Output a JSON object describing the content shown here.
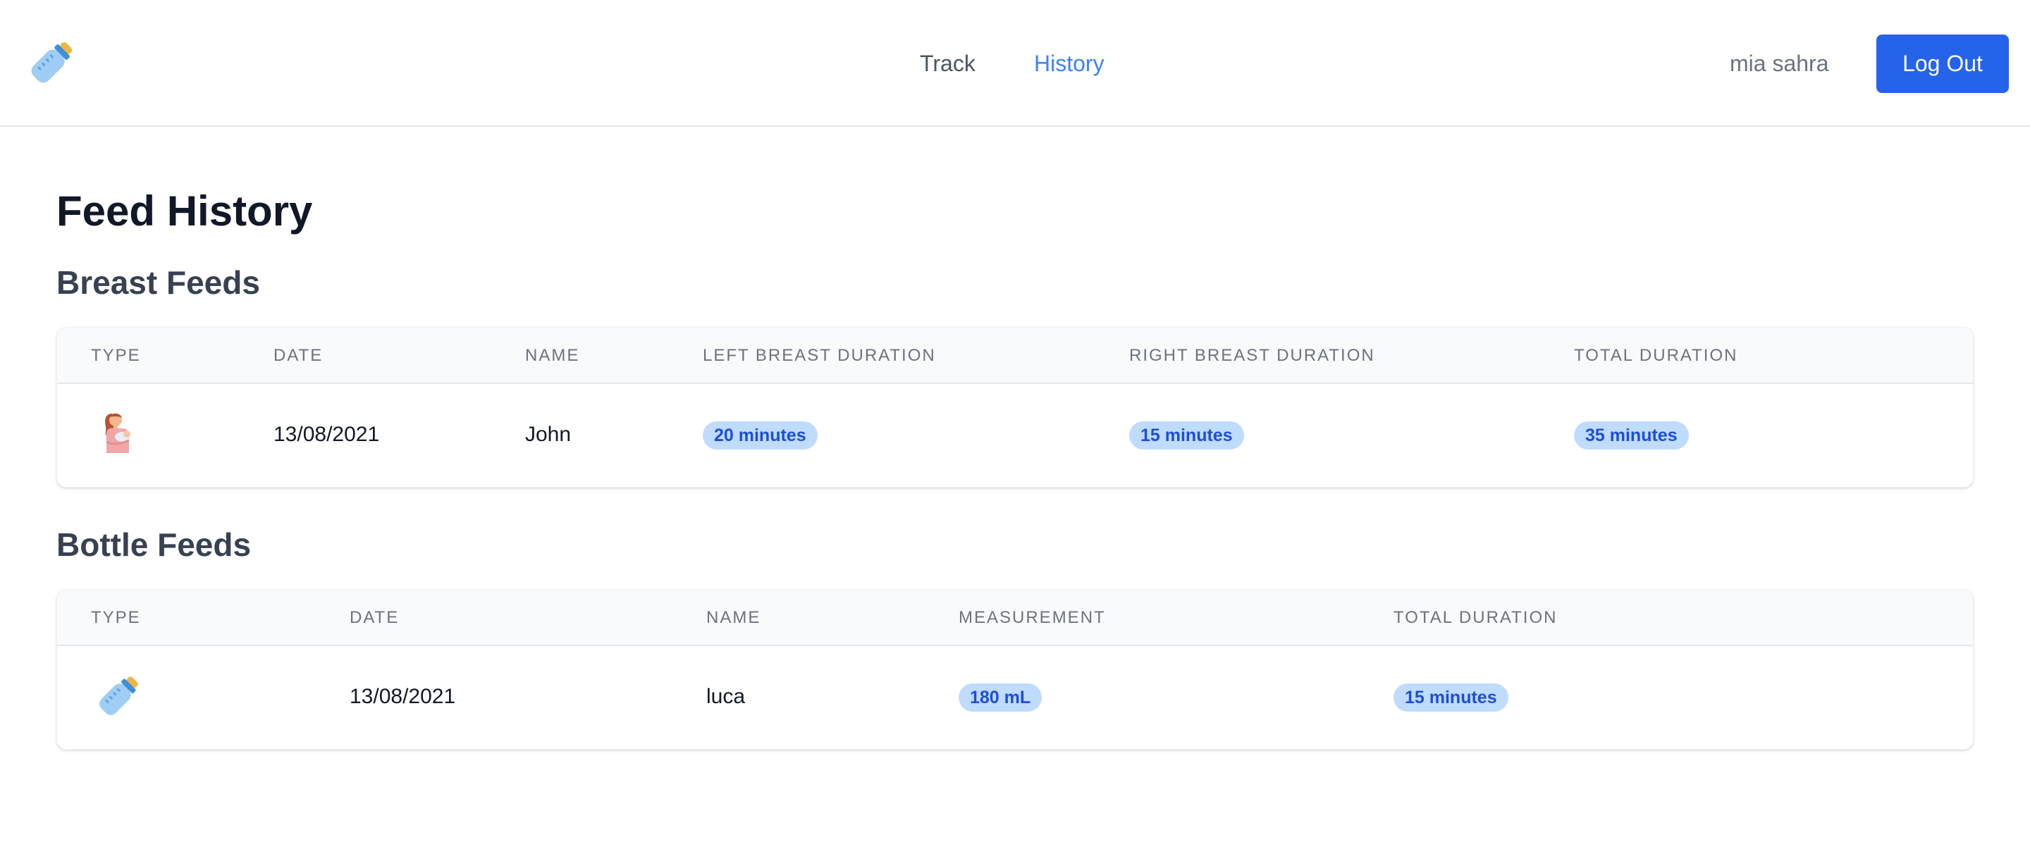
{
  "nav": {
    "logo_icon": "baby-bottle-icon",
    "links": [
      {
        "label": "Track",
        "active": false
      },
      {
        "label": "History",
        "active": true
      }
    ],
    "username": "mia sahra",
    "logout_label": "Log Out"
  },
  "page": {
    "title": "Feed History"
  },
  "breast_feeds": {
    "title": "Breast Feeds",
    "columns": [
      "Type",
      "Date",
      "Name",
      "Left Breast Duration",
      "Right Breast Duration",
      "Total Duration"
    ],
    "rows": [
      {
        "type_icon": "breastfeeding-icon",
        "date": "13/08/2021",
        "name": "John",
        "left_duration": "20 minutes",
        "right_duration": "15 minutes",
        "total_duration": "35 minutes"
      }
    ]
  },
  "bottle_feeds": {
    "title": "Bottle Feeds",
    "columns": [
      "Type",
      "Date",
      "Name",
      "Measurement",
      "Total Duration"
    ],
    "rows": [
      {
        "type_icon": "baby-bottle-icon",
        "date": "13/08/2021",
        "name": "luca",
        "measurement": "180 mL",
        "total_duration": "15 minutes"
      }
    ]
  },
  "colors": {
    "accent": "#2563eb",
    "active_link": "#3b82f6",
    "badge_bg": "#bfdbfe",
    "badge_text": "#1d4ed8"
  }
}
